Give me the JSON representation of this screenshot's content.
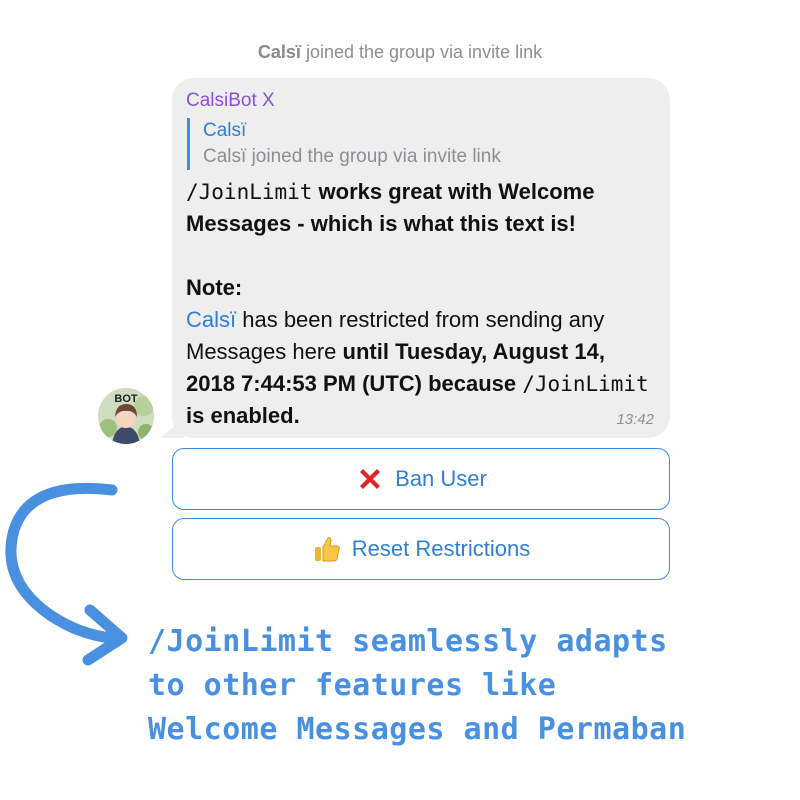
{
  "service_message": {
    "user": "Calsï",
    "text": " joined the group via invite link"
  },
  "message": {
    "sender": "CalsiBot X",
    "reply": {
      "name": "Calsï",
      "text": "Calsï joined the group via invite link"
    },
    "line1_cmd": "/JoinLimit",
    "line1_rest": " works great with Welcome Messages - which is what this text is!",
    "note_label": "Note:",
    "mention": "Calsï",
    "restricted_text": " has been restricted from sending any Messages here ",
    "until_text": "until Tuesday, August 14, 2018 7:44:53 PM (UTC) because ",
    "cmd2": "/JoinLimit",
    "enabled_text": " is enabled.",
    "time": "13:42"
  },
  "avatar": {
    "label": "BOT"
  },
  "buttons": {
    "ban": {
      "icon": "cross-mark-icon",
      "label": "Ban User"
    },
    "reset": {
      "icon": "thumbs-up-icon",
      "label": "Reset Restrictions"
    }
  },
  "caption": {
    "line1": "/JoinLimit seamlessly adapts",
    "line2": "to other features like",
    "line3": "Welcome Messages and Permaban"
  },
  "colors": {
    "accent": "#4a90e0",
    "link": "#2f7fd6",
    "sender": "#8b4fd8",
    "bubble": "#eeeeef",
    "ban_icon": "#e0242b"
  }
}
